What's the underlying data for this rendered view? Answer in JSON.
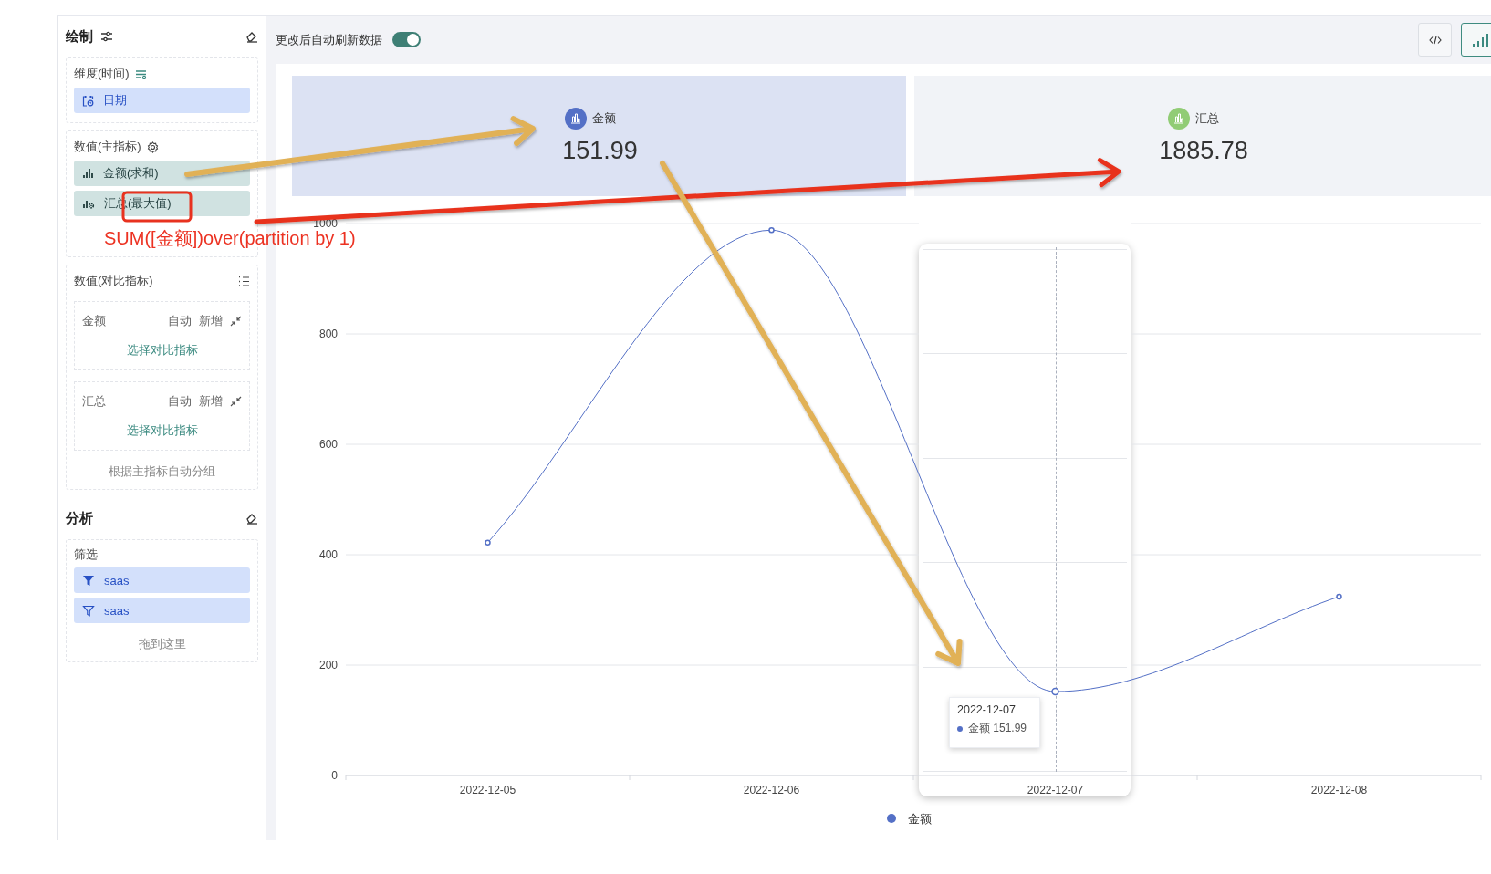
{
  "sidebar": {
    "title": "绘制",
    "dimension": {
      "title": "维度(时间)",
      "fields": [
        {
          "label": "日期"
        }
      ]
    },
    "measures": {
      "title": "数值(主指标)",
      "fields": [
        {
          "label": "金额(求和)",
          "kind": "sum"
        },
        {
          "label": "汇总(最大值)",
          "kind": "max"
        }
      ]
    },
    "compare": {
      "title": "数值(对比指标)",
      "groups": [
        {
          "name": "金额",
          "auto": "自动",
          "add": "新增",
          "link": "选择对比指标"
        },
        {
          "name": "汇总",
          "auto": "自动",
          "add": "新增",
          "link": "选择对比指标"
        }
      ],
      "footer": "根据主指标自动分组"
    },
    "analysis": {
      "title": "分析",
      "filter_title": "筛选",
      "filters": [
        {
          "label": "saas",
          "kind": "solid"
        },
        {
          "label": "saas",
          "kind": "outline"
        }
      ],
      "drop_hint": "拖到这里"
    }
  },
  "toolbar": {
    "auto_refresh": {
      "label": "更改后自动刷新数据",
      "on": true
    },
    "buttons": [
      {
        "kind": "code",
        "selected": false
      },
      {
        "kind": "chart",
        "selected": true
      }
    ]
  },
  "kpis": [
    {
      "label": "金额",
      "value": "151.99",
      "selected": true,
      "color": "#5470c6"
    },
    {
      "label": "汇总",
      "value": "1885.78",
      "selected": false,
      "color": "#91cc75"
    }
  ],
  "chart": {
    "chart_data": {
      "type": "line",
      "categories": [
        "2022-12-05",
        "2022-12-06",
        "2022-12-07",
        "2022-12-08"
      ],
      "series": [
        {
          "name": "金额",
          "color": "#5470c6",
          "marker": true,
          "values": [
            422,
            988,
            152,
            324
          ]
        }
      ],
      "grid": true,
      "ylim": [
        0,
        1000
      ],
      "yticks": [
        0,
        200,
        400,
        600,
        800,
        1000
      ]
    },
    "tooltip": {
      "title": "2022-12-07",
      "series_name": "金额",
      "value": "151.99"
    }
  },
  "annotation": {
    "note": "SUM([金额])over(partition by 1)"
  }
}
